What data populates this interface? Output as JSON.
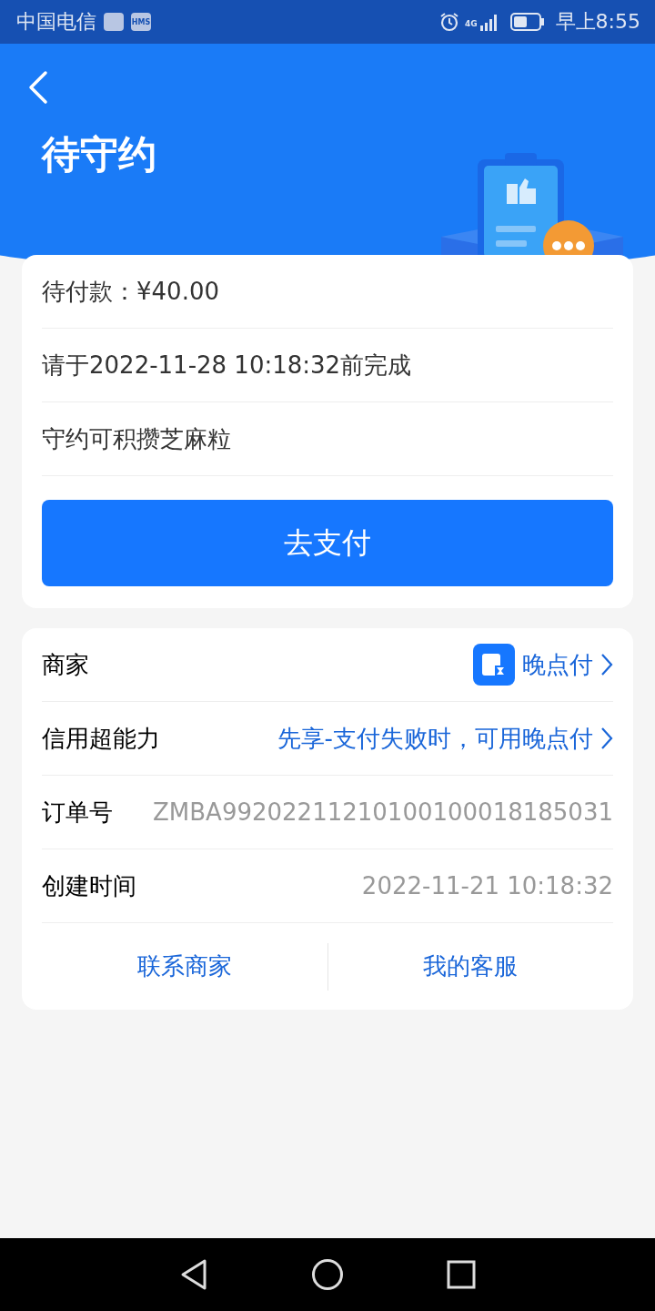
{
  "status_bar": {
    "carrier": "中国电信",
    "badge": "HMS",
    "network": "4G",
    "time": "早上8:55"
  },
  "header": {
    "title": "待守约"
  },
  "payment_card": {
    "lines": [
      "待付款：¥40.00",
      "请于2022-11-28 10:18:32前完成",
      "守约可积攒芝麻粒"
    ],
    "button": "去支付"
  },
  "details": {
    "rows": [
      {
        "kind": "merchant",
        "label": "商家",
        "value": "晚点付"
      },
      {
        "kind": "link",
        "label": "信用超能力",
        "value": "先享-支付失败时，可用晚点付"
      },
      {
        "kind": "plain",
        "label": "订单号",
        "value": "ZMBA99202211210100100018185031"
      },
      {
        "kind": "plain",
        "label": "创建时间",
        "value": "2022-11-21 10:18:32"
      }
    ],
    "actions": [
      "联系商家",
      "我的客服"
    ]
  }
}
